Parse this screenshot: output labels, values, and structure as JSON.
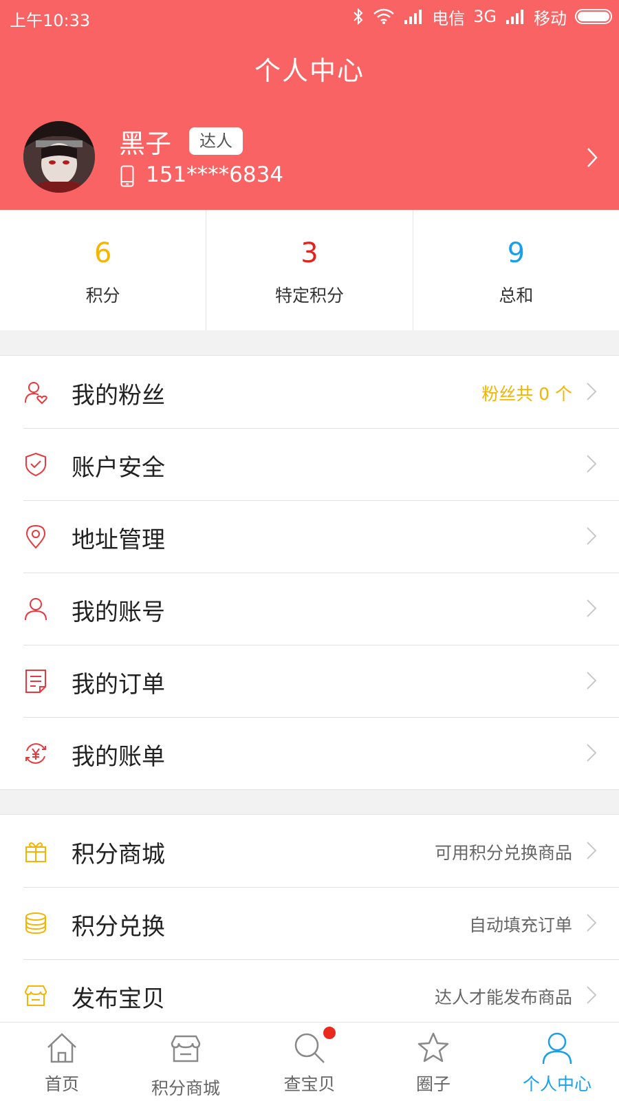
{
  "status_bar": {
    "time": "上午10:33",
    "carrier1": "电信",
    "network": "3G",
    "carrier2": "移动"
  },
  "header": {
    "title": "个人中心",
    "name": "黑子",
    "badge": "达人",
    "phone": "151****6834"
  },
  "stats": [
    {
      "value": "6",
      "label": "积分",
      "color": "#f5b400"
    },
    {
      "value": "3",
      "label": "特定积分",
      "color": "#e3221c"
    },
    {
      "value": "9",
      "label": "总和",
      "color": "#1aa0e8"
    }
  ],
  "menu1": [
    {
      "label": "我的粉丝",
      "sub": "粉丝共 0 个",
      "icon": "fans-icon"
    },
    {
      "label": "账户安全",
      "sub": "",
      "icon": "shield-icon"
    },
    {
      "label": "地址管理",
      "sub": "",
      "icon": "location-icon"
    },
    {
      "label": "我的账号",
      "sub": "",
      "icon": "user-icon"
    },
    {
      "label": "我的订单",
      "sub": "",
      "icon": "order-icon"
    },
    {
      "label": "我的账单",
      "sub": "",
      "icon": "bill-icon"
    }
  ],
  "menu2": [
    {
      "label": "积分商城",
      "sub": "可用积分兑换商品",
      "icon": "gift-icon"
    },
    {
      "label": "积分兑换",
      "sub": "自动填充订单",
      "icon": "coins-icon"
    },
    {
      "label": "发布宝贝",
      "sub": "达人才能发布商品",
      "icon": "store-icon"
    }
  ],
  "tabbar": [
    {
      "label": "首页",
      "icon": "home-icon"
    },
    {
      "label": "积分商城",
      "icon": "shop-icon"
    },
    {
      "label": "查宝贝",
      "icon": "search-icon"
    },
    {
      "label": "圈子",
      "icon": "star-icon"
    },
    {
      "label": "个人中心",
      "icon": "person-icon",
      "active": true
    }
  ],
  "colors": {
    "header_bg": "#fa6363",
    "icon_red": "#e8383d",
    "icon_yellow": "#f5b400",
    "active_blue": "#1aa0e8"
  }
}
